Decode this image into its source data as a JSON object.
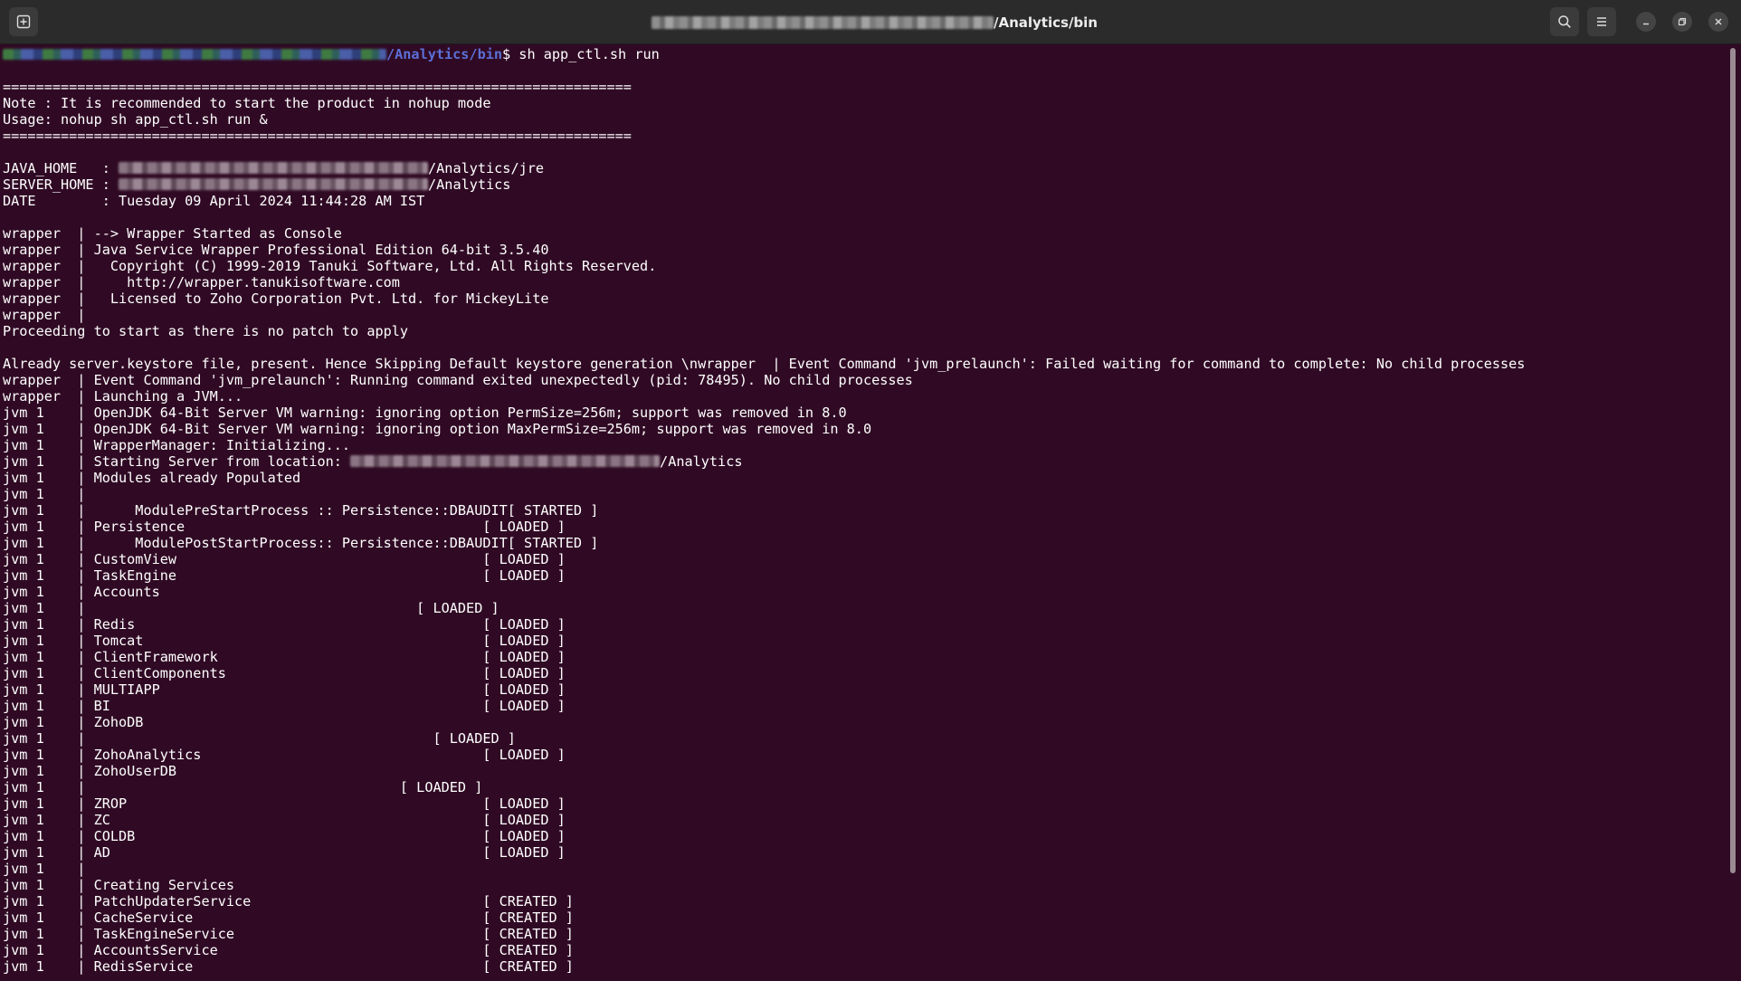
{
  "window": {
    "title_path": "/Analytics/bin",
    "colors": {
      "background": "#300a24",
      "titlebar": "#2b2b2b",
      "text": "#ffffff",
      "path": "#5b6fd6"
    },
    "icons": {
      "new_tab": "new-tab-icon",
      "search": "search-icon",
      "menu": "hamburger-menu-icon",
      "minimize": "minimize-icon",
      "maximize": "maximize-icon",
      "close": "close-icon"
    }
  },
  "terminal": {
    "prompt_path": "/Analytics/bin",
    "prompt_command": "$ sh app_ctl.sh run",
    "lines": [
      "",
      "============================================================================",
      "Note : It is recommended to start the product in nohup mode",
      "Usage: nohup sh app_ctl.sh run &",
      "============================================================================",
      "",
      "JAVA_HOME   : ",
      "SERVER_HOME : ",
      "DATE        : Tuesday 09 April 2024 11:44:28 AM IST",
      "",
      "wrapper  | --> Wrapper Started as Console",
      "wrapper  | Java Service Wrapper Professional Edition 64-bit 3.5.40",
      "wrapper  |   Copyright (C) 1999-2019 Tanuki Software, Ltd. All Rights Reserved.",
      "wrapper  |     http://wrapper.tanukisoftware.com",
      "wrapper  |   Licensed to Zoho Corporation Pvt. Ltd. for MickeyLite",
      "wrapper  |",
      "Proceeding to start as there is no patch to apply",
      "",
      "Already server.keystore file, present. Hence Skipping Default keystore generation \\nwrapper  | Event Command 'jvm_prelaunch': Failed waiting for command to complete: No child processes",
      "wrapper  | Event Command 'jvm_prelaunch': Running command exited unexpectedly (pid: 78495). No child processes",
      "wrapper  | Launching a JVM...",
      "jvm 1    | OpenJDK 64-Bit Server VM warning: ignoring option PermSize=256m; support was removed in 8.0",
      "jvm 1    | OpenJDK 64-Bit Server VM warning: ignoring option MaxPermSize=256m; support was removed in 8.0",
      "jvm 1    | WrapperManager: Initializing...",
      "jvm 1    | Starting Server from location: ",
      "jvm 1    | Modules already Populated",
      "jvm 1    |",
      "jvm 1    |      ModulePreStartProcess :: Persistence::DBAUDIT[ STARTED ]",
      "jvm 1    | Persistence                                    [ LOADED ]",
      "jvm 1    |      ModulePostStartProcess:: Persistence::DBAUDIT[ STARTED ]",
      "jvm 1    | CustomView                                     [ LOADED ]",
      "jvm 1    | TaskEngine                                     [ LOADED ]",
      "jvm 1    | Accounts",
      "jvm 1    |                                        [ LOADED ]",
      "jvm 1    | Redis                                          [ LOADED ]",
      "jvm 1    | Tomcat                                         [ LOADED ]",
      "jvm 1    | ClientFramework                                [ LOADED ]",
      "jvm 1    | ClientComponents                               [ LOADED ]",
      "jvm 1    | MULTIAPP                                       [ LOADED ]",
      "jvm 1    | BI                                             [ LOADED ]",
      "jvm 1    | ZohoDB",
      "jvm 1    |                                          [ LOADED ]",
      "jvm 1    | ZohoAnalytics                                  [ LOADED ]",
      "jvm 1    | ZohoUserDB",
      "jvm 1    |                                      [ LOADED ]",
      "jvm 1    | ZROP                                           [ LOADED ]",
      "jvm 1    | ZC                                             [ LOADED ]",
      "jvm 1    | COLDB                                          [ LOADED ]",
      "jvm 1    | AD                                             [ LOADED ]",
      "jvm 1    |",
      "jvm 1    | Creating Services",
      "jvm 1    | PatchUpdaterService                            [ CREATED ]",
      "jvm 1    | CacheService                                   [ CREATED ]",
      "jvm 1    | TaskEngineService                              [ CREATED ]",
      "jvm 1    | AccountsService                                [ CREATED ]",
      "jvm 1    | RedisService                                   [ CREATED ]"
    ],
    "java_home_suffix": "/Analytics/jre",
    "server_home_suffix": "/Analytics",
    "server_location_suffix": "/Analytics"
  }
}
